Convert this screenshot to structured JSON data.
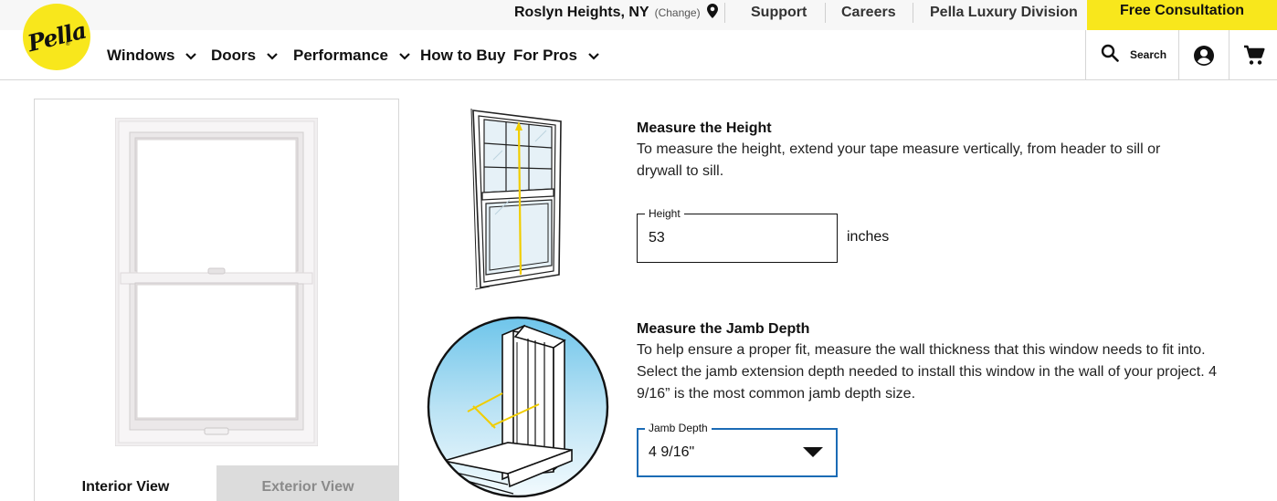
{
  "header": {
    "logo_text": "Pella",
    "location": {
      "city": "Roslyn Heights, NY",
      "change_label": "(Change)"
    },
    "utility_links": [
      "Support",
      "Careers",
      "Pella Luxury Division"
    ],
    "consultation_button": "Free Consultation",
    "nav": [
      {
        "label": "Windows",
        "has_dropdown": true
      },
      {
        "label": "Doors",
        "has_dropdown": true
      },
      {
        "label": "Performance",
        "has_dropdown": true
      },
      {
        "label": "How to Buy",
        "has_dropdown": false
      },
      {
        "label": "For Pros",
        "has_dropdown": true
      }
    ],
    "search_label": "Search",
    "icons": [
      "search-icon",
      "account-icon",
      "cart-icon",
      "location-pin-icon",
      "chevron-down-icon"
    ],
    "accent_color": "#f8e71c"
  },
  "preview": {
    "tabs": [
      {
        "label": "Interior View",
        "active": true
      },
      {
        "label": "Exterior View",
        "active": false
      }
    ]
  },
  "height_section": {
    "title": "Measure the Height",
    "description": "To measure the height, extend your tape measure vertically, from header to sill or drywall to sill.",
    "field_label": "Height",
    "value": "53",
    "units": "inches"
  },
  "jamb_section": {
    "title": "Measure the Jamb Depth",
    "description": "To help ensure a proper fit, measure the wall thickness that this window needs to fit into. Select the jamb extension depth needed to install this window in the wall of your project. 4 9/16” is the most common jamb depth size.",
    "field_label": "Jamb Depth",
    "selected": "4 9/16\"",
    "focus_color": "#1b6bb5"
  }
}
